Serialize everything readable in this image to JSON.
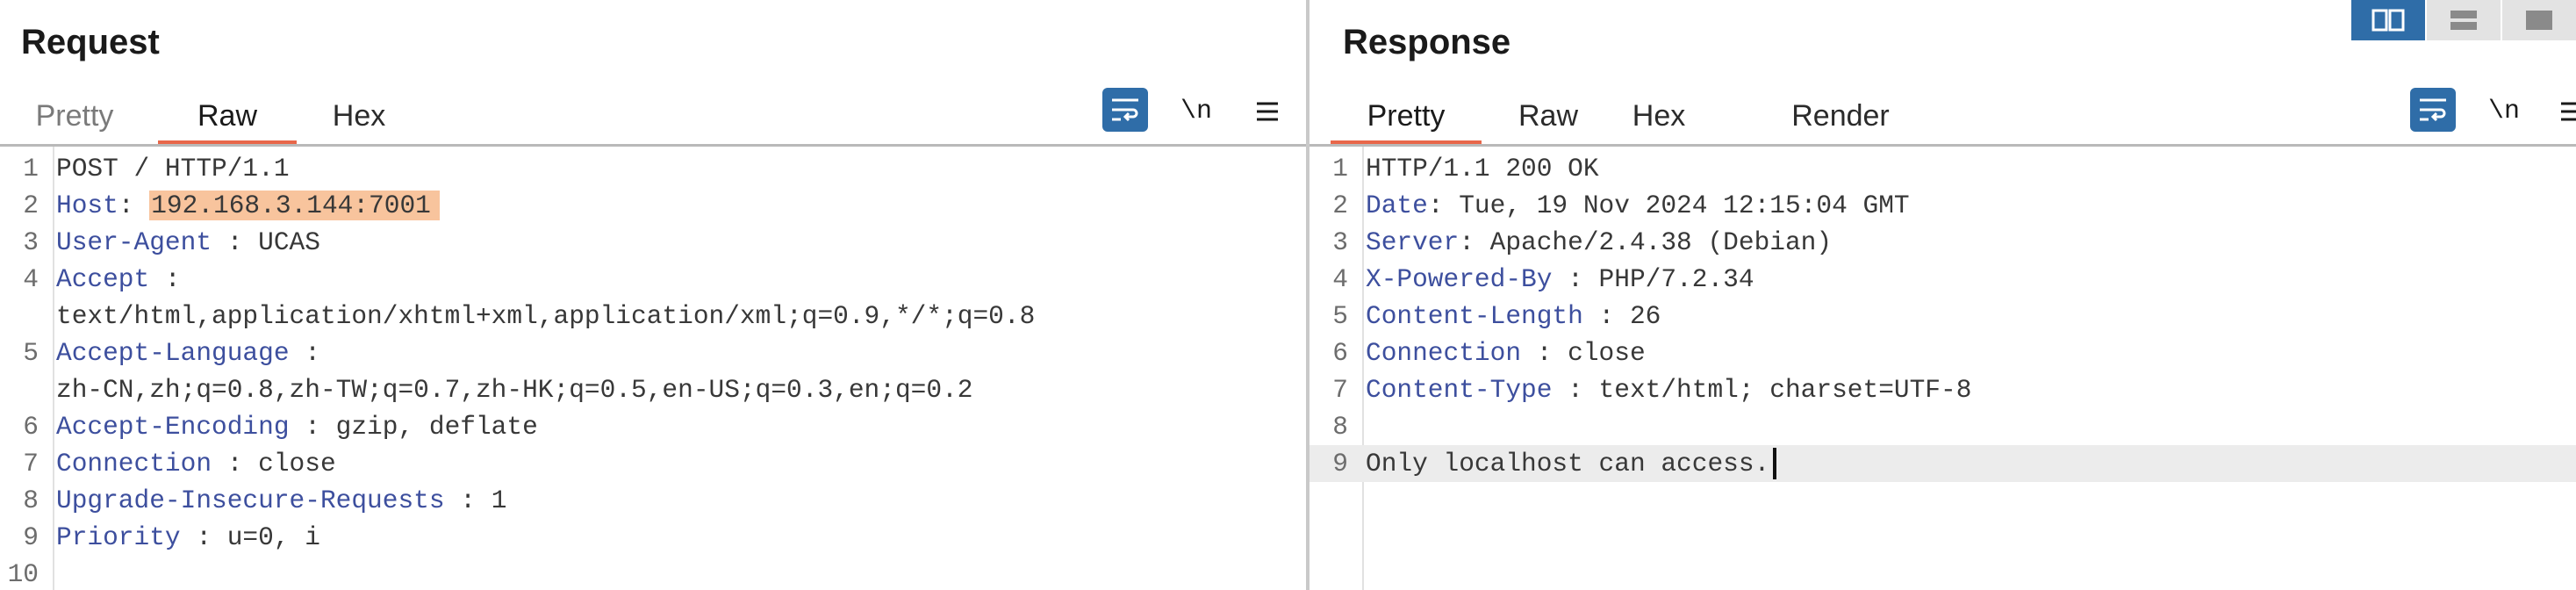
{
  "request": {
    "title": "Request",
    "tabs": [
      "Pretty",
      "Raw",
      "Hex"
    ],
    "active_tab": "Raw",
    "toolbar": {
      "wrap_icon": "wrap-lines-icon",
      "newline_label": "\\n",
      "menu_icon": "hamburger-menu-icon"
    },
    "lines": [
      {
        "num": "1",
        "key": "",
        "sep": "",
        "value": "POST / HTTP/1.1"
      },
      {
        "num": "2",
        "key": "Host",
        "sep": ": ",
        "value": "192.168.3.144:7001",
        "highlight": true
      },
      {
        "num": "3",
        "key": "User-Agent",
        "sep": " : ",
        "value": "UCAS"
      },
      {
        "num": "4",
        "key": "Accept",
        "sep": " :",
        "value": ""
      },
      {
        "num": "",
        "key": "",
        "sep": "",
        "value": "text/html,application/xhtml+xml,application/xml;q=0.9,*/*;q=0.8"
      },
      {
        "num": "5",
        "key": "Accept-Language",
        "sep": " :",
        "value": ""
      },
      {
        "num": "",
        "key": "",
        "sep": "",
        "value": "zh-CN,zh;q=0.8,zh-TW;q=0.7,zh-HK;q=0.5,en-US;q=0.3,en;q=0.2"
      },
      {
        "num": "6",
        "key": "Accept-Encoding",
        "sep": " : ",
        "value": "gzip, deflate"
      },
      {
        "num": "7",
        "key": "Connection",
        "sep": " : ",
        "value": "close"
      },
      {
        "num": "8",
        "key": "Upgrade-Insecure-Requests",
        "sep": " : ",
        "value": "1"
      },
      {
        "num": "9",
        "key": "Priority",
        "sep": " : ",
        "value": "u=0, i"
      },
      {
        "num": "10",
        "key": "",
        "sep": "",
        "value": ""
      }
    ]
  },
  "response": {
    "title": "Response",
    "tabs": [
      "Pretty",
      "Raw",
      "Hex",
      "Render"
    ],
    "active_tab": "Pretty",
    "toolbar": {
      "wrap_icon": "wrap-lines-icon",
      "newline_label": "\\n",
      "menu_icon": "hamburger-menu-icon"
    },
    "lines": [
      {
        "num": "1",
        "key": "",
        "sep": "",
        "value": "HTTP/1.1 200 OK"
      },
      {
        "num": "2",
        "key": "Date",
        "sep": ": ",
        "value": "Tue, 19 Nov 2024 12:15:04 GMT"
      },
      {
        "num": "3",
        "key": "Server",
        "sep": ": ",
        "value": "Apache/2.4.38 (Debian)"
      },
      {
        "num": "4",
        "key": "X-Powered-By",
        "sep": " : ",
        "value": "PHP/7.2.34"
      },
      {
        "num": "5",
        "key": "Content-Length",
        "sep": " : ",
        "value": "26"
      },
      {
        "num": "6",
        "key": "Connection",
        "sep": " : ",
        "value": "close"
      },
      {
        "num": "7",
        "key": "Content-Type",
        "sep": " : ",
        "value": "text/html; charset=UTF-8"
      },
      {
        "num": "8",
        "key": "",
        "sep": "",
        "value": ""
      },
      {
        "num": "9",
        "key": "",
        "sep": "",
        "value": "Only localhost can access.",
        "current": true
      }
    ]
  },
  "layout_buttons": [
    {
      "icon": "split-horizontal-icon",
      "active": true
    },
    {
      "icon": "split-vertical-icon",
      "active": false
    },
    {
      "icon": "single-pane-icon",
      "active": false
    }
  ],
  "colors": {
    "accent": "#e8674a",
    "primary_button": "#2f6da8",
    "header_key": "#3d4f9e",
    "highlight": "#f8c49d"
  }
}
